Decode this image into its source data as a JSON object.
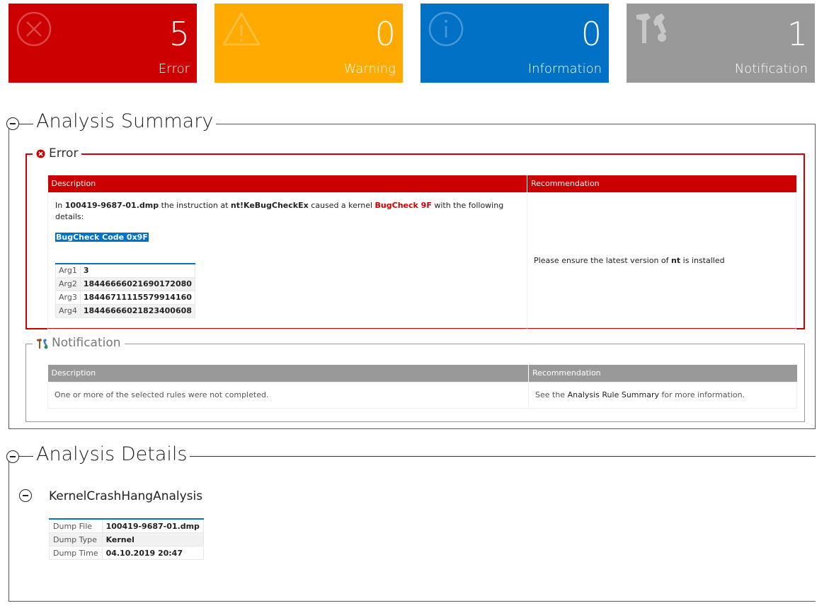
{
  "tiles": {
    "error": {
      "count": "5",
      "label": "Error"
    },
    "warning": {
      "count": "0",
      "label": "Warning"
    },
    "information": {
      "count": "0",
      "label": "Information"
    },
    "notification": {
      "count": "1",
      "label": "Notification"
    }
  },
  "colors": {
    "error": "#cc0000",
    "warning": "#ffaa00",
    "information": "#0071c5",
    "notification": "#999999"
  },
  "summary": {
    "title": "Analysis Summary",
    "error_group": {
      "legend": "Error",
      "col_description": "Description",
      "col_recommendation": "Recommendation",
      "desc_in": "In",
      "desc_file": "100419-9687-01.dmp",
      "desc_mid": "the instruction at",
      "desc_symbol": "nt!KeBugCheckEx",
      "desc_caused": "caused a kernel",
      "desc_bugcheck": "BugCheck 9F",
      "desc_tail": "with the following details:",
      "bugcheck_code": "BugCheck Code 0x9F",
      "args": [
        {
          "key": "Arg1",
          "value": "3"
        },
        {
          "key": "Arg2",
          "value": "18446666021690172080"
        },
        {
          "key": "Arg3",
          "value": "18446711115579914160"
        },
        {
          "key": "Arg4",
          "value": "18446666021823400608"
        }
      ],
      "rec_prefix": "Please ensure the latest version of",
      "rec_module": "nt",
      "rec_suffix": "is installed"
    },
    "notification_group": {
      "legend": "Notification",
      "col_description": "Description",
      "col_recommendation": "Recommendation",
      "description": "One or more of the selected rules were not completed.",
      "rec_prefix": "See the",
      "rec_link": "Analysis Rule Summary",
      "rec_suffix": "for more information."
    }
  },
  "details": {
    "title": "Analysis Details",
    "analysis_name": "KernelCrashHangAnalysis",
    "rows": [
      {
        "key": "Dump File",
        "value": "100419-9687-01.dmp"
      },
      {
        "key": "Dump Type",
        "value": "Kernel"
      },
      {
        "key": "Dump Time",
        "value": "04.10.2019 20:47"
      }
    ]
  }
}
